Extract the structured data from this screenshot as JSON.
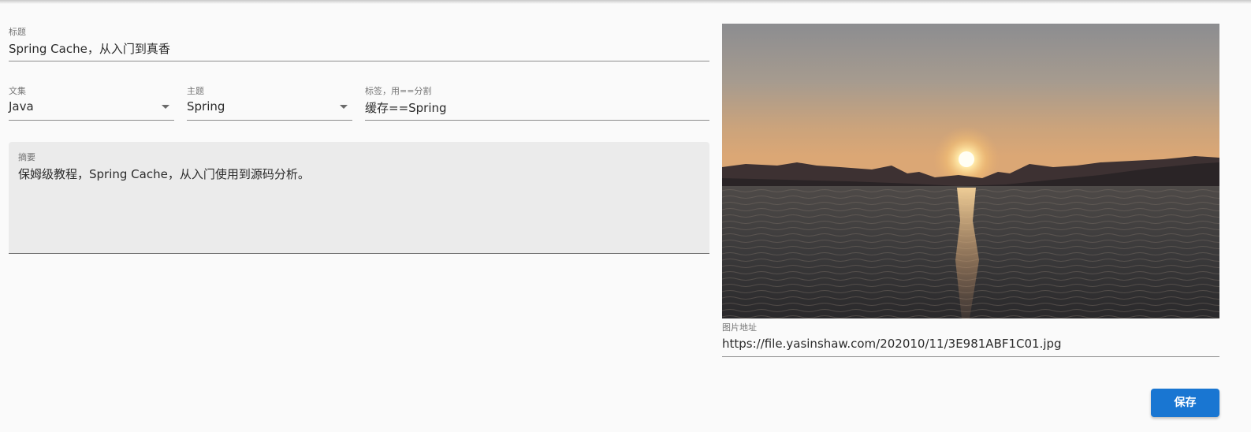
{
  "form": {
    "title": {
      "label": "标题",
      "value": "Spring Cache，从入门到真香"
    },
    "collection": {
      "label": "文集",
      "value": "Java",
      "icon": "dropdown-arrow-icon"
    },
    "topic": {
      "label": "主题",
      "value": "Spring",
      "icon": "dropdown-arrow-icon"
    },
    "tags": {
      "label": "标签，用==分割",
      "value": "缓存==Spring"
    },
    "summary": {
      "label": "摘要",
      "value": "保姆级教程，Spring Cache，从入门使用到源码分析。"
    },
    "image_url": {
      "label": "图片地址",
      "value": "https://file.yasinshaw.com/202010/11/3E981ABF1C01.jpg"
    },
    "save_label": "保存"
  },
  "colors": {
    "background": "#fafafa",
    "summary_background": "#ebebeb",
    "button": "#1976d2",
    "button_text": "#ffffff"
  }
}
